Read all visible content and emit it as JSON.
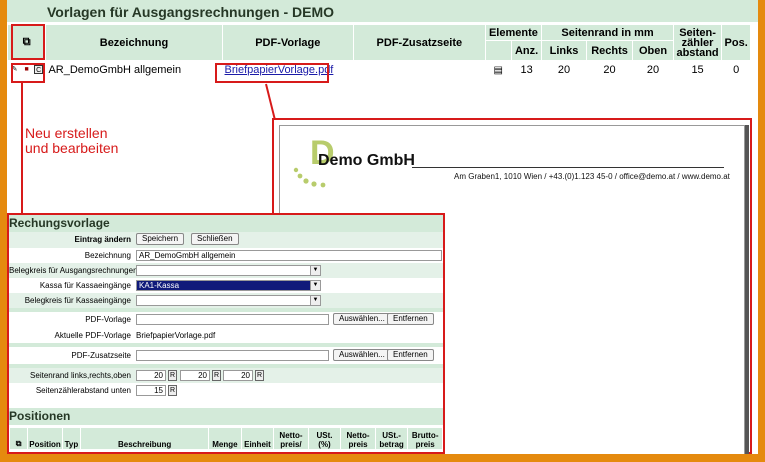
{
  "page_title": "Vorlagen für Ausgangsrechnungen - DEMO",
  "list": {
    "add_icon": "add-document-icon",
    "headers": {
      "bezeichnung": "Bezeichnung",
      "pdf_vorlage": "PDF-Vorlage",
      "pdf_zusatz": "PDF-Zusatzseite",
      "elemente": "Elemente",
      "seitenrand": "Seitenrand in mm",
      "seitenzaehler": "Seiten-\nzähler\nabstand",
      "pos": "Pos.",
      "anz": "Anz.",
      "links": "Links",
      "rechts": "Rechts",
      "oben": "Oben"
    },
    "row": {
      "name": "AR_DemoGmbH allgemein",
      "pdf": "BriefpapierVorlage.pdf",
      "pdf_zusatz": "",
      "anz": "13",
      "links": "20",
      "rechts": "20",
      "oben": "20",
      "abstand": "15",
      "pos": "0",
      "copy_label": "C"
    }
  },
  "annotation": {
    "line1": "Neu erstellen",
    "line2": "und bearbeiten"
  },
  "preview": {
    "logo_letter": "D",
    "company": "Demo GmbH",
    "address": "Am Graben1, 1010 Wien / +43.(0)1.123 45-0 / office@demo.at / www.demo.at"
  },
  "form": {
    "section_title": "Rechungsvorlage",
    "entry_label": "Eintrag ändern",
    "save_button": "Speichern",
    "close_button": "Schließen",
    "bezeichnung_label": "Bezeichnung",
    "bezeichnung_value": "AR_DemoGmbH allgemein",
    "belegkreis_label": "Belegkreis für Ausgangsrechnungen",
    "belegkreis_value": "",
    "kassa_label": "Kassa für Kassaeingänge",
    "kassa_value": "KA1-Kassa",
    "belegkreis_kassa_label": "Belegkreis für Kassaeingänge",
    "belegkreis_kassa_value": "",
    "pdf_label": "PDF-Vorlage",
    "pdf_value": "",
    "choose_button": "Auswählen...",
    "remove_button": "Entfernen",
    "current_pdf_label": "Aktuelle PDF-Vorlage",
    "current_pdf_value": "BriefpapierVorlage.pdf",
    "zusatz_label": "PDF-Zusatzseite",
    "zusatz_value": "",
    "margin_label": "Seitenrand links,rechts,oben",
    "margin_left": "20",
    "margin_right": "20",
    "margin_top": "20",
    "counter_label": "Seitenzählerabstand unten",
    "counter_value": "15",
    "r_label": "R"
  },
  "positions": {
    "title": "Positionen",
    "headers": {
      "position": "Position",
      "typ": "Typ",
      "beschreibung": "Beschreibung",
      "menge": "Menge",
      "einheit": "Einheit",
      "netto_preis": "Netto-\npreis/",
      "ust": "USt.\n(%)",
      "netto_betrag": "Netto-\npreis",
      "ust_betrag": "USt.-\nbetrag",
      "brutto": "Brutto-\npreis"
    }
  }
}
